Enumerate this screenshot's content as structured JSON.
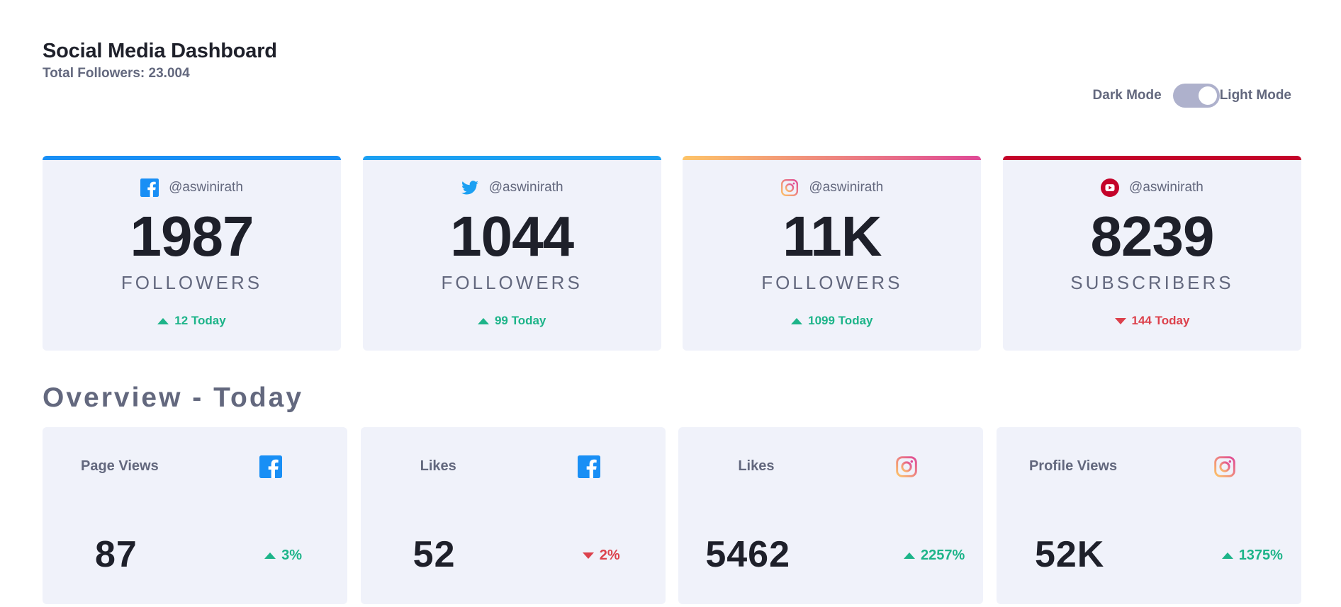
{
  "header": {
    "title": "Social Media Dashboard",
    "subtitle": "Total Followers: 23.004"
  },
  "toggle": {
    "dark_label": "Dark Mode",
    "light_label": "Light Mode",
    "state": "light"
  },
  "colors": {
    "facebook": "#198ff5",
    "twitter": "#1ca0f2",
    "instagram_start": "#fdc468",
    "instagram_end": "#df4996",
    "youtube": "#c4032a",
    "up": "#1db489",
    "down": "#dc414c"
  },
  "cards": [
    {
      "platform": "facebook",
      "icon": "facebook-icon",
      "handle": "@aswinirath",
      "count": "1987",
      "unit": "FOLLOWERS",
      "today": "12 Today",
      "trend": "up"
    },
    {
      "platform": "twitter",
      "icon": "twitter-icon",
      "handle": "@aswinirath",
      "count": "1044",
      "unit": "FOLLOWERS",
      "today": "99 Today",
      "trend": "up"
    },
    {
      "platform": "instagram",
      "icon": "instagram-icon",
      "handle": "@aswinirath",
      "count": "11K",
      "unit": "FOLLOWERS",
      "today": "1099 Today",
      "trend": "up"
    },
    {
      "platform": "youtube",
      "icon": "youtube-icon",
      "handle": "@aswinirath",
      "count": "8239",
      "unit": "SUBSCRIBERS",
      "today": "144 Today",
      "trend": "down"
    }
  ],
  "overview": {
    "title": "Overview - Today",
    "items": [
      {
        "label": "Page Views",
        "icon": "facebook-icon",
        "value": "87",
        "change": "3%",
        "trend": "up"
      },
      {
        "label": "Likes",
        "icon": "facebook-icon",
        "value": "52",
        "change": "2%",
        "trend": "down"
      },
      {
        "label": "Likes",
        "icon": "instagram-icon",
        "value": "5462",
        "change": "2257%",
        "trend": "up"
      },
      {
        "label": "Profile Views",
        "icon": "instagram-icon",
        "value": "52K",
        "change": "1375%",
        "trend": "up"
      }
    ]
  }
}
